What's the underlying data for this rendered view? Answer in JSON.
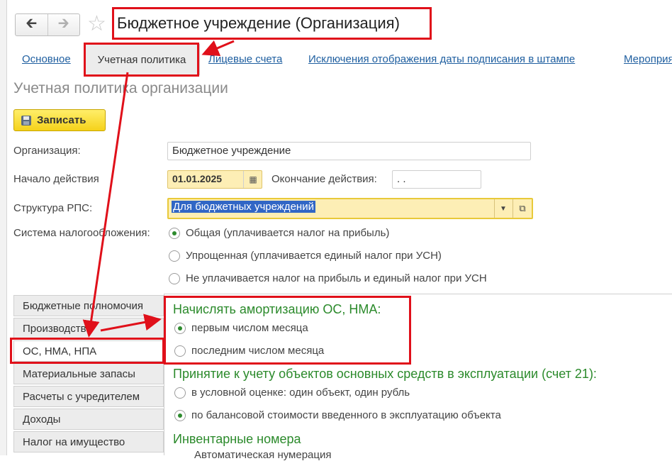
{
  "window": {
    "title": "Бюджетное учреждение (Организация)"
  },
  "nav": {
    "back_icon": "arrow-left-icon",
    "forward_icon": "arrow-right-icon",
    "star_icon": "star-icon"
  },
  "tabs": {
    "main": "Основное",
    "accounting_policy": "Учетная политика",
    "personal_accounts": "Лицевые счета",
    "exclusions": "Исключения отображения даты подписания в штампе",
    "events": "Мероприя"
  },
  "page": {
    "subtitle": "Учетная политика организации"
  },
  "toolbar": {
    "save_label": "Записать"
  },
  "form": {
    "org_label": "Организация:",
    "org_value": "Бюджетное учреждение",
    "start_label": "Начало действия",
    "start_value": "01.01.2025",
    "end_label": "Окончание действия:",
    "end_value": " .  .",
    "rps_label": "Структура РПС:",
    "rps_value": "Для бюджетных учреждений",
    "tax_label": "Система налогообложения:",
    "tax_options": [
      "Общая (уплачивается налог на прибыль)",
      "Упрощенная (уплачивается единый налог при УСН)",
      "Не уплачивается налог на прибыль и единый налог при УСН"
    ],
    "tax_selected": 0
  },
  "sections": [
    "Бюджетные полномочия",
    "Производство",
    "ОС, НМА, НПА",
    "Материальные запасы",
    "Расчеты с учредителем",
    "Доходы",
    "Налог на имущество"
  ],
  "active_section": 2,
  "content": {
    "depr_title": "Начислять амортизацию ОС, НМА:",
    "depr_options": [
      "первым числом месяца",
      "последним числом месяца"
    ],
    "depr_selected": 0,
    "accept_title": "Принятие к учету объектов основных средств в эксплуатации (счет 21):",
    "accept_options": [
      "в условной оценке: один объект, один рубль",
      "по балансовой стоимости введенного в эксплуатацию объекта"
    ],
    "accept_selected": 1,
    "inv_title": "Инвентарные номера",
    "inv_option": "Автоматическая нумерация"
  },
  "colors": {
    "annotation": "#e0101a",
    "accent_green": "#2b8a2b",
    "link": "#1f5fa0",
    "save_bg": "#f5d21a"
  }
}
